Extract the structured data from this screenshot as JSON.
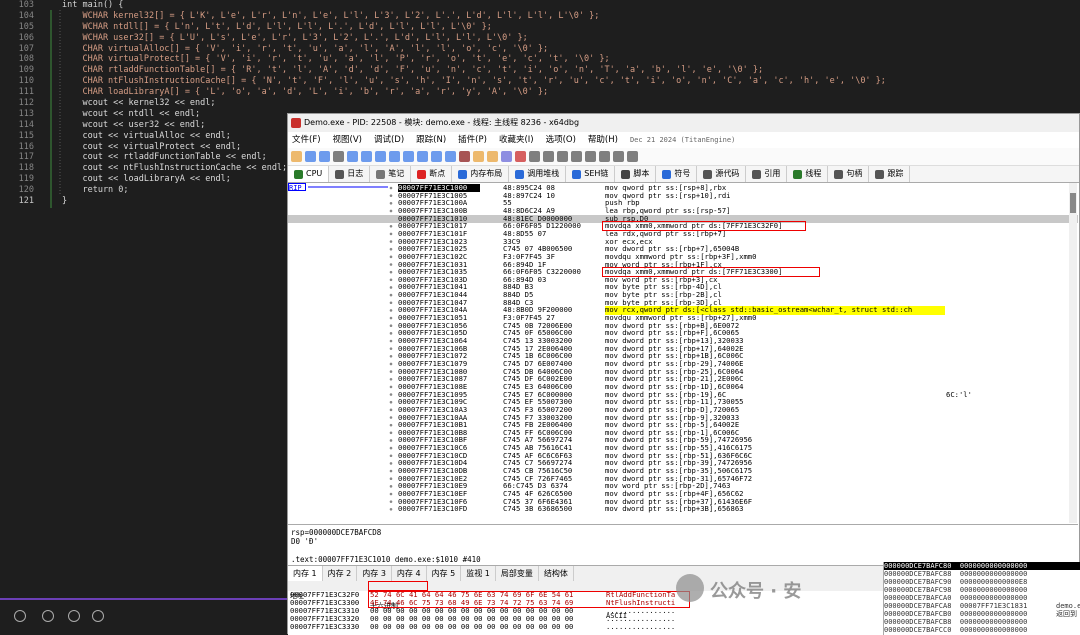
{
  "editor": {
    "line_numbers": [
      "103",
      "104",
      "105",
      "106",
      "107",
      "108",
      "109",
      "110",
      "111",
      "112",
      "113",
      "114",
      "115",
      "116",
      "117",
      "118",
      "119",
      "120",
      "121"
    ],
    "lines": [
      "int main() {",
      "    WCHAR kernel32[] = { L'K', L'e', L'r', L'n', L'e', L'l', L'3', L'2', L'.', L'd', L'l', L'l', L'\\0' };",
      "    WCHAR ntdll[] = { L'n', L't', L'd', L'l', L'l', L'.', L'd', L'l', L'l', L'\\0' };",
      "    WCHAR user32[] = { L'U', L's', L'e', L'r', L'3', L'2', L'.', L'd', L'l', L'l', L'\\0' };",
      "    CHAR virtualAlloc[] = { 'V', 'i', 'r', 't', 'u', 'a', 'l', 'A', 'l', 'l', 'o', 'c', '\\0' };",
      "    CHAR virtualProtect[] = { 'V', 'i', 'r', 't', 'u', 'a', 'l', 'P', 'r', 'o', 't', 'e', 'c', 't', '\\0' };",
      "    CHAR rtladdFunctionTable[] = { 'R', 't', 'l', 'A', 'd', 'd', 'F', 'u', 'n', 'c', 't', 'i', 'o', 'n', 'T', 'a', 'b', 'l', 'e', '\\0' };",
      "    CHAR ntFlushInstructionCache[] = { 'N', 't', 'F', 'l', 'u', 's', 'h', 'I', 'n', 's', 't', 'r', 'u', 'c', 't', 'i', 'o', 'n', 'C', 'a', 'c', 'h', 'e', '\\0' };",
      "    CHAR loadLibraryA[] = { 'L', 'o', 'a', 'd', 'L', 'i', 'b', 'r', 'a', 'r', 'y', 'A', '\\0' };",
      "    wcout << kernel32 << endl;",
      "    wcout << ntdll << endl;",
      "    wcout << user32 << endl;",
      "    cout << virtualAlloc << endl;",
      "    cout << virtualProtect << endl;",
      "    cout << rtladdFunctionTable << endl;",
      "    cout << ntFlushInstructionCache << endl;",
      "    cout << loadLibraryA << endl;",
      "    return 0;",
      "}"
    ]
  },
  "debugger": {
    "title": "Demo.exe - PID: 22508 - 模块: demo.exe - 线程: 主线程 8236 - x64dbg",
    "menu": [
      "文件(F)",
      "视图(V)",
      "调试(D)",
      "跟踪(N)",
      "插件(P)",
      "收藏夹(I)",
      "选项(O)",
      "帮助(H)"
    ],
    "build_date": "Dec 21 2024 (TitanEngine)",
    "tabs": [
      "CPU",
      "日志",
      "笔记",
      "断点",
      "内存布局",
      "调用堆栈",
      "SEH链",
      "脚本",
      "符号",
      "源代码",
      "引用",
      "线程",
      "句柄",
      "跟踪"
    ],
    "rip_label": "RIP",
    "rows": [
      {
        "addr": "00007FF71E3C1000",
        "bytes": "48:895C24 08",
        "ins": "mov qword ptr ss:[rsp+8],rbx"
      },
      {
        "addr": "00007FF71E3C1005",
        "bytes": "48:897C24 10",
        "ins": "mov qword ptr ss:[rsp+10],rdi"
      },
      {
        "addr": "00007FF71E3C100A",
        "bytes": "55",
        "ins": "push rbp"
      },
      {
        "addr": "00007FF71E3C100B",
        "bytes": "48:8D6C24 A9",
        "ins": "lea rbp,qword ptr ss:[rsp-57]"
      },
      {
        "addr": "00007FF71E3C1010",
        "bytes": "48:81EC D0000000",
        "ins": "sub rsp,D0"
      },
      {
        "addr": "00007FF71E3C1017",
        "bytes": "66:0F6F05 D1220000",
        "ins": "movdqa xmm0,xmmword ptr ds:[7FF71E3C32F0]"
      },
      {
        "addr": "00007FF71E3C101F",
        "bytes": "48:8D55 07",
        "ins": "lea rdx,qword ptr ss:[rbp+7]"
      },
      {
        "addr": "00007FF71E3C1023",
        "bytes": "33C9",
        "ins": "xor ecx,ecx"
      },
      {
        "addr": "00007FF71E3C1025",
        "bytes": "C745 07 4B006500",
        "ins": "mov dword ptr ss:[rbp+7],65004B"
      },
      {
        "addr": "00007FF71E3C102C",
        "bytes": "F3:0F7F45 3F",
        "ins": "movdqu xmmword ptr ss:[rbp+3F],xmm0"
      },
      {
        "addr": "00007FF71E3C1031",
        "bytes": "66:894D 1F",
        "ins": "mov word ptr ss:[rbp+1F],cx"
      },
      {
        "addr": "00007FF71E3C1035",
        "bytes": "66:0F6F05 C3220000",
        "ins": "movdqa xmm0,xmmword ptr ds:[7FF71E3C3300]"
      },
      {
        "addr": "00007FF71E3C103D",
        "bytes": "66:894D 03",
        "ins": "mov word ptr ss:[rbp+3],cx"
      },
      {
        "addr": "00007FF71E3C1041",
        "bytes": "884D B3",
        "ins": "mov byte ptr ss:[rbp-4D],cl"
      },
      {
        "addr": "00007FF71E3C1044",
        "bytes": "884D D5",
        "ins": "mov byte ptr ss:[rbp-2B],cl"
      },
      {
        "addr": "00007FF71E3C1047",
        "bytes": "884D C3",
        "ins": "mov byte ptr ss:[rbp-3D],cl"
      },
      {
        "addr": "00007FF71E3C104A",
        "bytes": "48:8B0D 9F200000",
        "ins": "mov rcx,qword ptr ds:[<class std::basic_ostream<wchar_t, struct std::ch"
      },
      {
        "addr": "00007FF71E3C1051",
        "bytes": "F3:0F7F45 27",
        "ins": "movdqu xmmword ptr ss:[rbp+27],xmm0"
      },
      {
        "addr": "00007FF71E3C1056",
        "bytes": "C745 0B 72006E00",
        "ins": "mov dword ptr ss:[rbp+B],6E0072"
      },
      {
        "addr": "00007FF71E3C105D",
        "bytes": "C745 0F 65006C00",
        "ins": "mov dword ptr ss:[rbp+F],6C0065"
      },
      {
        "addr": "00007FF71E3C1064",
        "bytes": "C745 13 33003200",
        "ins": "mov dword ptr ss:[rbp+13],320033"
      },
      {
        "addr": "00007FF71E3C106B",
        "bytes": "C745 17 2E006400",
        "ins": "mov dword ptr ss:[rbp+17],64002E"
      },
      {
        "addr": "00007FF71E3C1072",
        "bytes": "C745 1B 6C006C00",
        "ins": "mov dword ptr ss:[rbp+1B],6C006C"
      },
      {
        "addr": "00007FF71E3C1079",
        "bytes": "C745 D7 6E007400",
        "ins": "mov dword ptr ss:[rbp-29],74006E"
      },
      {
        "addr": "00007FF71E3C1080",
        "bytes": "C745 DB 64006C00",
        "ins": "mov dword ptr ss:[rbp-25],6C0064"
      },
      {
        "addr": "00007FF71E3C1087",
        "bytes": "C745 DF 6C002E00",
        "ins": "mov dword ptr ss:[rbp-21],2E006C"
      },
      {
        "addr": "00007FF71E3C108E",
        "bytes": "C745 E3 64006C00",
        "ins": "mov dword ptr ss:[rbp-1D],6C0064"
      },
      {
        "addr": "00007FF71E3C1095",
        "bytes": "C745 E7 6C000000",
        "ins": "mov dword ptr ss:[rbp-19],6C",
        "cmt": "6C:'l'"
      },
      {
        "addr": "00007FF71E3C109C",
        "bytes": "C745 EF 55007300",
        "ins": "mov dword ptr ss:[rbp-11],730055"
      },
      {
        "addr": "00007FF71E3C10A3",
        "bytes": "C745 F3 65007200",
        "ins": "mov dword ptr ss:[rbp-D],720065"
      },
      {
        "addr": "00007FF71E3C10AA",
        "bytes": "C745 F7 33003200",
        "ins": "mov dword ptr ss:[rbp-9],320033"
      },
      {
        "addr": "00007FF71E3C10B1",
        "bytes": "C745 FB 2E006400",
        "ins": "mov dword ptr ss:[rbp-5],64002E"
      },
      {
        "addr": "00007FF71E3C10B8",
        "bytes": "C745 FF 6C006C00",
        "ins": "mov dword ptr ss:[rbp-1],6C006C"
      },
      {
        "addr": "00007FF71E3C10BF",
        "bytes": "C745 A7 56697274",
        "ins": "mov dword ptr ss:[rbp-59],74726956"
      },
      {
        "addr": "00007FF71E3C10C6",
        "bytes": "C745 AB 75616C41",
        "ins": "mov dword ptr ss:[rbp-55],416C6175"
      },
      {
        "addr": "00007FF71E3C10CD",
        "bytes": "C745 AF 6C6C6F63",
        "ins": "mov dword ptr ss:[rbp-51],636F6C6C"
      },
      {
        "addr": "00007FF71E3C10D4",
        "bytes": "C745 C7 56697274",
        "ins": "mov dword ptr ss:[rbp-39],74726956"
      },
      {
        "addr": "00007FF71E3C10DB",
        "bytes": "C745 CB 75616C50",
        "ins": "mov dword ptr ss:[rbp-35],506C6175"
      },
      {
        "addr": "00007FF71E3C10E2",
        "bytes": "C745 CF 726F7465",
        "ins": "mov dword ptr ss:[rbp-31],65746F72"
      },
      {
        "addr": "00007FF71E3C10E9",
        "bytes": "66:C745 D3 6374",
        "ins": "mov word ptr ss:[rbp-2D],7463"
      },
      {
        "addr": "00007FF71E3C10EF",
        "bytes": "C745 4F 626C6500",
        "ins": "mov dword ptr ss:[rbp+4F],656C62"
      },
      {
        "addr": "00007FF71E3C10F6",
        "bytes": "C745 37 6F6E4361",
        "ins": "mov dword ptr ss:[rbp+37],61436E6F"
      },
      {
        "addr": "00007FF71E3C10FD",
        "bytes": "C745 3B 63686500",
        "ins": "mov dword ptr ss:[rbp+3B],656863"
      }
    ],
    "info_lines": [
      "rsp=000000DCE7BAFCD8",
      "D0 'Ð'",
      "",
      ".text:00007FF71E3C1010 demo.exe:$1010 #410"
    ],
    "mem_tabs": [
      "内存 1",
      "内存 2",
      "内存 3",
      "内存 4",
      "内存 5",
      "监视 1",
      "局部变量",
      "结构体"
    ],
    "dump_header": {
      "addr": "地址",
      "hex": "十六进制",
      "ascii": "ASCII"
    },
    "dump_rows": [
      {
        "addr": "00007FF71E3C32F0",
        "hex": "52 74 6C 41 64 64 46 75 6E 63 74 69 6F 6E 54 61",
        "ascii": "RtlAddFunctionTa"
      },
      {
        "addr": "00007FF71E3C3300",
        "hex": "4E 74 46 6C 75 73 68 49 6E 73 74 72 75 63 74 69",
        "ascii": "NtFlushInstructi"
      },
      {
        "addr": "00007FF71E3C3310",
        "hex": "00 00 00 00 00 00 00 00 00 00 00 00 00 00 00 00",
        "ascii": "................"
      },
      {
        "addr": "00007FF71E3C3320",
        "hex": "00 00 00 00 00 00 00 00 00 00 00 00 00 00 00 00",
        "ascii": "................"
      },
      {
        "addr": "00007FF71E3C3330",
        "hex": "00 00 00 00 00 00 00 00 00 00 00 00 00 00 00 00",
        "ascii": "................"
      }
    ],
    "stack_rows": [
      "000000DCE7BAFC80  0000000000000000",
      "000000DCE7BAFC88  0000000000000000",
      "000000DCE7BAFC90  00000000000000E8",
      "000000DCE7BAFC98  0000000000000000",
      "000000DCE7BAFCA0  0000000000000000",
      "000000DCE7BAFCA8  00007FF71E3C1831",
      "000000DCE7BAFCB0  0000000000000000",
      "000000DCE7BAFCB8  0000000000000000",
      "000000DCE7BAFCC0  0000000000000000"
    ],
    "stack_side": [
      "demo.exe",
      "返回到"
    ]
  },
  "watermark": "公众号 · 安"
}
